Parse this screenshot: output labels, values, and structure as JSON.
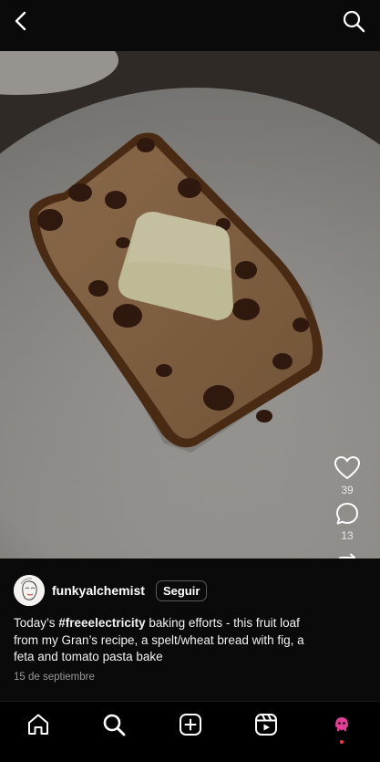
{
  "header": {
    "back_icon": "chevron-left-icon",
    "search_icon": "search-icon"
  },
  "actions": {
    "like_icon": "heart-icon",
    "like_count": "39",
    "comment_icon": "comment-icon",
    "comment_count": "13",
    "repost_icon": "repost-icon",
    "share_icon": "send-icon",
    "more_icon": "more-icon"
  },
  "post": {
    "username": "funkyalchemist",
    "follow_label": "Seguir",
    "caption_prefix": "Today’s ",
    "caption_hashtag": "#freeelectricity",
    "caption_rest": " baking efforts - this fruit loaf from my Gran’s recipe, a spelt/wheat bread with fig, a feta and tomato pasta bake",
    "date": "15 de septiembre"
  },
  "nav": {
    "items": [
      "home-icon",
      "search-icon",
      "create-icon",
      "reels-icon",
      "profile-icon"
    ]
  },
  "colors": {
    "accent_profile": "#e23e97",
    "notification_dot": "#ff3040"
  }
}
